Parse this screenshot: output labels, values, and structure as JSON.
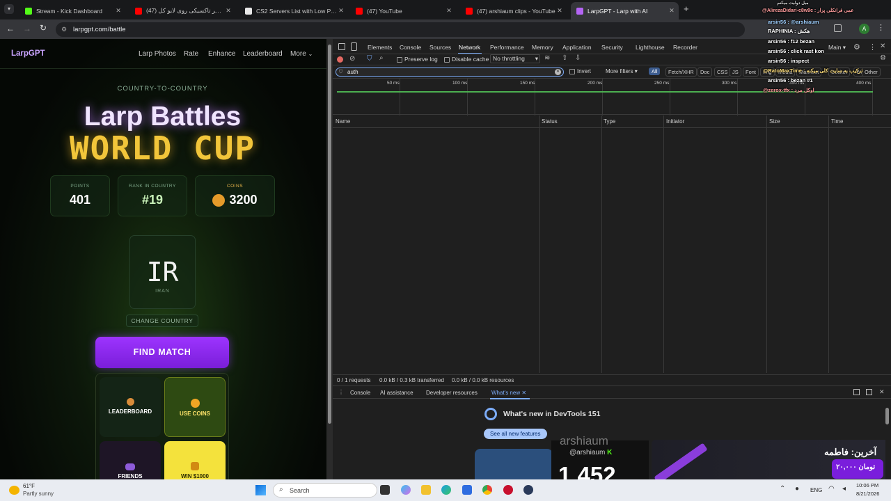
{
  "tabs": [
    {
      "title": "Stream - Kick Dashboard",
      "color": "#53fc18"
    },
    {
      "title": "(47) اگر تاکسیکی روی لایو کل...",
      "color": "#ff0000"
    },
    {
      "title": "CS2 Servers List with Low Ping",
      "color": "#e8e8e8"
    },
    {
      "title": "(47) YouTube",
      "color": "#ff0000"
    },
    {
      "title": "(47) arshiaum clips - YouTube",
      "color": "#ff0000"
    },
    {
      "title": "LarpGPT - Larp with AI",
      "color": "#b565f5"
    }
  ],
  "address": {
    "url": "larpgpt.com/battle"
  },
  "site": {
    "brand": "LarpGPT",
    "nav": [
      "Larp Photos",
      "Rate",
      "Enhance",
      "Leaderboard",
      "More"
    ],
    "subtitle": "COUNTRY-TO-COUNTRY",
    "title_line1": "Larp Battles",
    "title_line2": "WORLD CUP",
    "stats": [
      {
        "label": "POINTS",
        "value": "401"
      },
      {
        "label": "RANK IN COUNTRY",
        "value": "#19"
      },
      {
        "label": "COINS",
        "value": "3200"
      }
    ],
    "country_code": "IR",
    "country_name": "IRAN",
    "change_country": "CHANGE COUNTRY",
    "find_match": "FIND MATCH",
    "tiles": [
      "LEADERBOARD",
      "USE COINS",
      "FRIENDS",
      "WIN $1000"
    ]
  },
  "devtools": {
    "panels": [
      "Elements",
      "Console",
      "Sources",
      "Network",
      "Performance",
      "Memory",
      "Application",
      "Security",
      "Lighthouse",
      "Recorder"
    ],
    "active_panel": "Network",
    "target": "Main",
    "preserve_log": "Preserve log",
    "disable_cache": "Disable cache",
    "throttling": "No throttling",
    "filter_value": "auth",
    "invert": "Invert",
    "more_filters": "More filters",
    "filter_types": [
      "All",
      "Fetch/XHR",
      "Doc",
      "CSS",
      "JS",
      "Font",
      "Img",
      "Media",
      "Manifest",
      "Socket",
      "Wasm",
      "Other"
    ],
    "timeline_ticks": [
      "50 ms",
      "100 ms",
      "150 ms",
      "200 ms",
      "250 ms",
      "300 ms",
      "350 ms",
      "400 ms"
    ],
    "columns": [
      "Name",
      "Status",
      "Type",
      "Initiator",
      "Size",
      "Time"
    ],
    "status_bar": [
      "0 / 1 requests",
      "0.0 kB / 0.3 kB transferred",
      "0.0 kB / 0.0 kB resources"
    ],
    "drawer_tabs": [
      "Console",
      "AI assistance",
      "Developer resources",
      "What's new"
    ],
    "whats_new_title": "What's new in DevTools 151",
    "see_all": "See all new features"
  },
  "chat": [
    "میل دولیت میکنم",
    "@AlirezaDidari-c8w9c : عمی فرانکلی پزار",
    "arsin56 : @arshiaum",
    "RAPHINIA : هکش",
    "arsin56 : f12 bezan",
    "arsin56 : click rast kon",
    "arsin56 : inspect",
    "@RatoMaxTime : ترکیب به سایت کلی میکنه",
    "arsin56 : bezan #1",
    "@zerox-tfx : اوکل مرد"
  ],
  "overlay": {
    "streamer": "arshiaum",
    "handle": "@arshiaum",
    "viewers": "1,452",
    "donation_label": "آخرین: فاطمه",
    "donation_amount": "۲۰,۰۰۰ تومان"
  },
  "taskbar": {
    "temp": "61°F",
    "weather": "Partly sunny",
    "search": "Search",
    "lang": "ENG",
    "time": "10:06 PM",
    "date": "8/21/2026"
  }
}
